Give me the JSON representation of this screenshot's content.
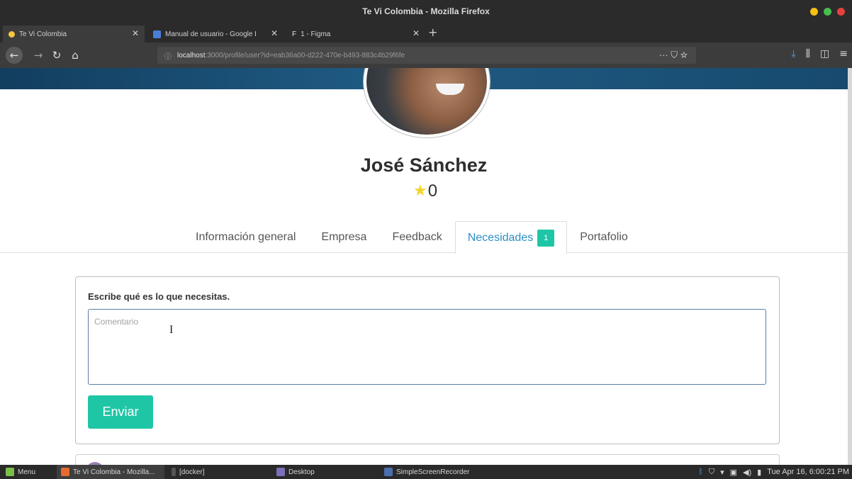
{
  "window": {
    "title": "Te Vi Colombia - Mozilla Firefox",
    "controls": {
      "minimize_color": "#f5c211",
      "maximize_color": "#44c04f",
      "close_color": "#e8413c"
    }
  },
  "browser_tabs": [
    {
      "label": "Te Vi Colombia",
      "icon": "firefox-tab-icon",
      "active": true
    },
    {
      "label": "Manual de usuario - Google I",
      "icon": "google-docs-icon",
      "active": false
    },
    {
      "label": "1 - Figma",
      "icon": "figma-icon",
      "active": false
    }
  ],
  "navbar": {
    "url_info_icon": "ⓘ",
    "url_host": "localhost",
    "url_path": ":3000/profile/user?id=eab36a00-d222-470e-b493-883c4b29f6fe",
    "page_actions": "··· ⛉ ☆"
  },
  "profile": {
    "name": "José Sánchez",
    "rating": "0",
    "star_color": "#f3d52b",
    "cover_color": "#1a4f75"
  },
  "profile_tabs": [
    {
      "label": "Información general",
      "active": false
    },
    {
      "label": "Empresa",
      "active": false
    },
    {
      "label": "Feedback",
      "active": false
    },
    {
      "label": "Necesidades",
      "active": true,
      "badge": "1"
    },
    {
      "label": "Portafolio",
      "active": false
    }
  ],
  "needs_form": {
    "label": "Escribe qué es lo que necesitas.",
    "comment_placeholder": "Comentario",
    "comment_value": "",
    "submit_label": "Enviar",
    "accent_color": "#1fc6a6"
  },
  "taskbar": {
    "menu_label": "Menu",
    "items": [
      {
        "label": "Te Vi Colombia - Mozilla...",
        "active": true
      },
      {
        "label": "[docker]",
        "active": false
      },
      {
        "label": "Desktop",
        "active": false
      },
      {
        "label": "SimpleScreenRecorder",
        "active": false
      }
    ],
    "clock": "Tue Apr 16,  6:00:21 PM"
  }
}
